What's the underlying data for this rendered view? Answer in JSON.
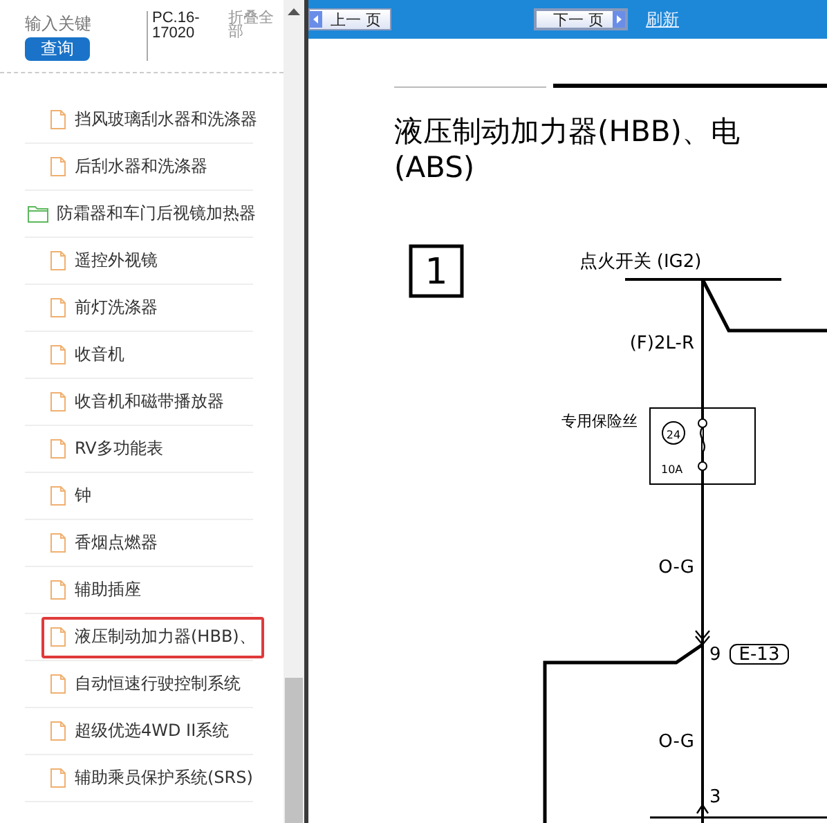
{
  "sidebar": {
    "search": {
      "placeholder": "输入关键"
    },
    "search_button": "查询",
    "code": "PC.16-17020",
    "collapse_all": "折叠全部",
    "continued_items": [
      {
        "label": "挡风玻璃刮水器和洗涤器",
        "selected": false
      },
      {
        "label": "后刮水器和洗涤器",
        "selected": false
      }
    ],
    "folders": [
      {
        "label": "防霜器和车门后视镜加热器",
        "selected": false,
        "children": [
          {
            "label": "遥控外视镜",
            "selected": false
          },
          {
            "label": "前灯洗涤器",
            "selected": false
          },
          {
            "label": "收音机",
            "selected": false
          },
          {
            "label": "收音机和磁带播放器",
            "selected": false
          },
          {
            "label": "RV多功能表",
            "selected": false
          },
          {
            "label": "钟",
            "selected": false
          },
          {
            "label": "香烟点燃器",
            "selected": false
          },
          {
            "label": "辅助插座",
            "selected": false
          },
          {
            "label": "液压制动加力器(HBB)、",
            "selected": true
          },
          {
            "label": "自动恒速行驶控制系统",
            "selected": false
          },
          {
            "label": "超级优选4WD II系统",
            "selected": false
          },
          {
            "label": "辅助乘员保护系统(SRS)",
            "selected": false
          }
        ]
      }
    ]
  },
  "toolbar": {
    "prev_button": "上一 页",
    "next_button": "下一 页",
    "refresh_link": "刷新"
  },
  "document": {
    "title_lines": [
      "液压制动加力器(HBB)、电",
      "(ABS)"
    ],
    "figure_number": "1",
    "diagram": {
      "switch_label": "点火开关 (IG2)",
      "wire_label_top": "(F)2L-R",
      "fuse_label": "专用保险丝",
      "fuse_number": "24",
      "fuse_rating": "10A",
      "wire_label_middle": "O-G",
      "connector_pin": "9",
      "connector_id": "E-13",
      "wire_label_lower": "O-G",
      "pin_lower": "3"
    }
  }
}
